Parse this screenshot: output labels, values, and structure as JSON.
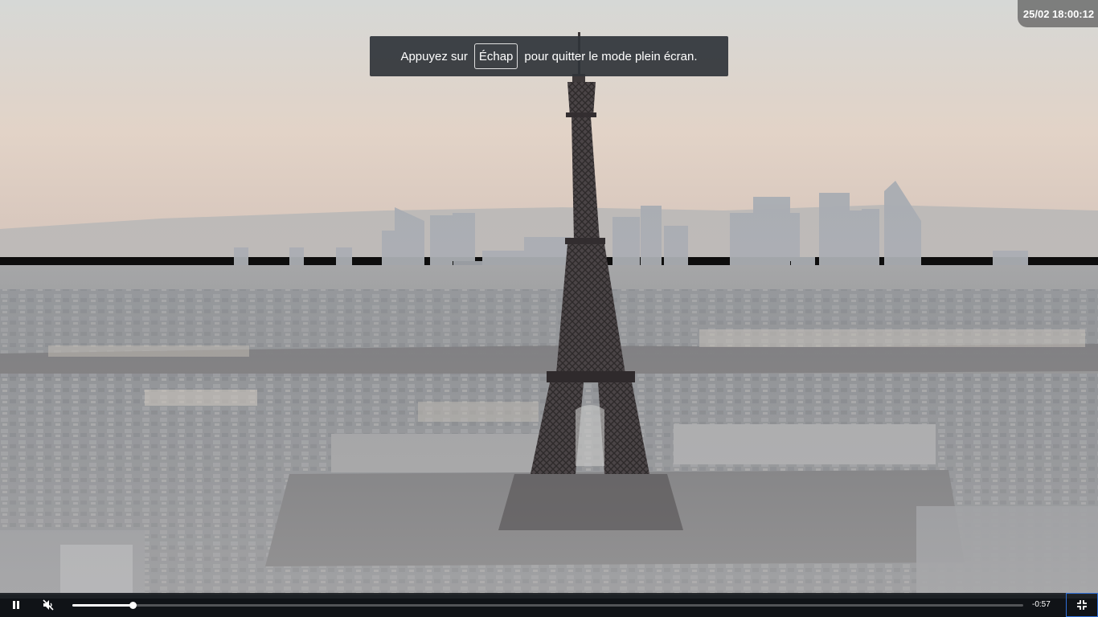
{
  "overlay": {
    "timestamp": "25/02 18:00:12"
  },
  "toast": {
    "prefix": "Appuyez sur",
    "key": "Échap",
    "suffix": "pour quitter le mode plein écran."
  },
  "player": {
    "progress": 0.063,
    "time_remaining": "-0:57",
    "icons": {
      "play_pause": "pause-icon",
      "mute": "speaker-muted-icon",
      "fullscreen": "exit-fullscreen-icon"
    }
  },
  "colors": {
    "sky_top": "#d7d7d4",
    "sky_horizon": "#e6d6c8",
    "haze": "#a9aaa8",
    "city": "#7d8288",
    "tower": "#3f3a3b",
    "accent_focus": "#2f6fd8"
  }
}
